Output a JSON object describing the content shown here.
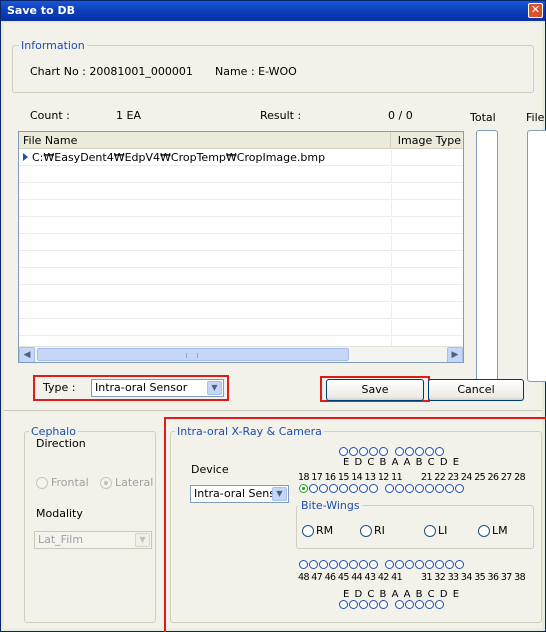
{
  "window": {
    "title": "Save to DB",
    "close_glyph": "✕"
  },
  "information": {
    "legend": "Information",
    "chart_no": "Chart No : 20081001_000001",
    "name": "Name : E-WOO"
  },
  "status": {
    "count_label": "Count :",
    "count_value": "1 EA",
    "result_label": "Result :",
    "result_value": "0 / 0",
    "total_label": "Total",
    "file_label": "File"
  },
  "file_list": {
    "columns": [
      "File Name",
      "Image Type"
    ],
    "rows": [
      {
        "file_name": "C:₩EasyDent4₩EdpV4₩CropTemp₩CropImage.bmp",
        "image_type": ""
      }
    ]
  },
  "type_selector": {
    "label": "Type :",
    "value": "Intra-oral Sensor"
  },
  "buttons": {
    "save": "Save",
    "cancel": "Cancel"
  },
  "cephalo": {
    "legend": "Cephalo",
    "direction_label": "Direction",
    "frontal": "Frontal",
    "lateral": "Lateral",
    "selected": "Lateral",
    "modality_label": "Modality",
    "modality_value": "Lat_Film"
  },
  "intraoral": {
    "legend": "Intra-oral X-Ray & Camera",
    "device_label": "Device",
    "device_value": "Intra-oral Sens",
    "upper_primary_letters": "E D C B A   A B C D E",
    "upper_numbers_right": "18 17 16 15 14 13 12 11",
    "upper_numbers_left": "21 22 23 24 25 26 27 28",
    "lower_numbers_right": "48 47 46 45 44 43 42 41",
    "lower_numbers_left": "31 32 33 34 35 36 37 38",
    "lower_primary_letters": "E D C B A   A B C D E",
    "selected_tooth": "18",
    "bite_wings": {
      "legend": "Bite-Wings",
      "options": [
        "RM",
        "RI",
        "LI",
        "LM"
      ]
    }
  },
  "icons": {
    "arrow": "play-arrow-icon",
    "dropdown": "chevron-down-icon",
    "scroll_left": "arrow-left-icon",
    "scroll_right": "arrow-right-icon"
  },
  "colors": {
    "title_bar": "#0A3FB8",
    "highlight_box": "#E11A1A",
    "group_text": "#1C4FB0",
    "selected_radio": "#21A121"
  }
}
